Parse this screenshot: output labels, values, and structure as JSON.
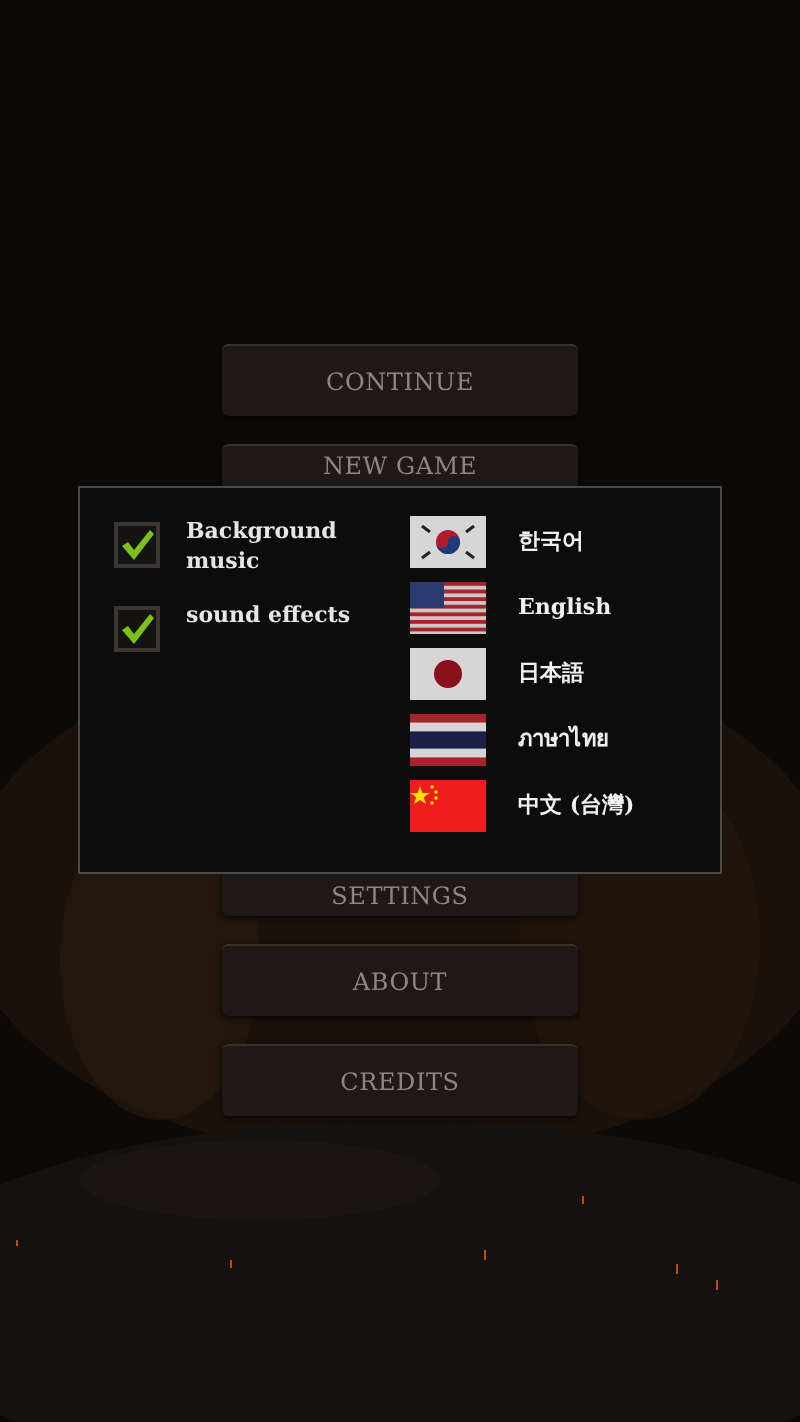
{
  "menu": [
    {
      "label": "CONTINUE"
    },
    {
      "label": "NEW GAME"
    },
    {
      "label": "SETTINGS"
    },
    {
      "label": "ABOUT"
    },
    {
      "label": "CREDITS"
    }
  ],
  "settings_dialog": {
    "options": [
      {
        "label": "Background music",
        "checked": true
      },
      {
        "label": "sound effects",
        "checked": true
      }
    ],
    "languages": [
      {
        "label": "한국어",
        "kind": "korea"
      },
      {
        "label": "English",
        "kind": "usa"
      },
      {
        "label": "日本語",
        "kind": "japan"
      },
      {
        "label": "ภาษาไทย",
        "kind": "thailand"
      },
      {
        "label": "中文 (台灣)",
        "kind": "china"
      }
    ]
  }
}
